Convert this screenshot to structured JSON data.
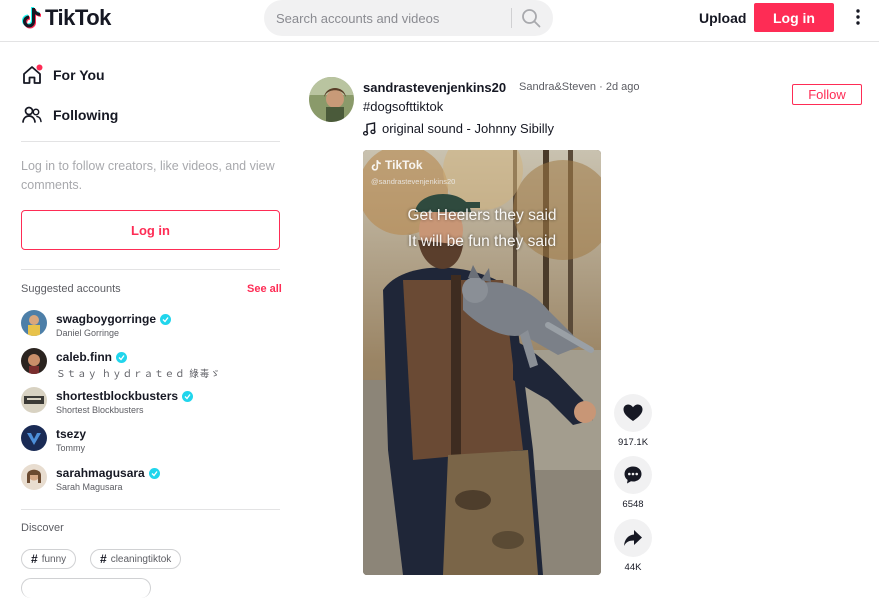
{
  "header": {
    "logo_text": "TikTok",
    "search_placeholder": "Search accounts and videos",
    "upload_label": "Upload",
    "login_label": "Log in"
  },
  "sidebar": {
    "nav": [
      {
        "label": "For You",
        "icon": "home-icon",
        "notification_dot": true
      },
      {
        "label": "Following",
        "icon": "following-icon"
      }
    ],
    "login_hint": "Log in to follow creators, like videos, and view comments.",
    "login_label": "Log in",
    "suggested_title": "Suggested accounts",
    "see_all": "See all",
    "accounts": [
      {
        "username": "swagboygorringe",
        "display": "Daniel Gorringe",
        "verified": true
      },
      {
        "username": "caleb.finn",
        "display": "Ｓｔａｙ ｈｙｄｒａｔｅｄ 綠毒ゞ",
        "verified": true
      },
      {
        "username": "shortestblockbusters",
        "display": "Shortest Blockbusters",
        "verified": true
      },
      {
        "username": "tsezy",
        "display": "Tommy",
        "verified": false
      },
      {
        "username": "sarahmagusara",
        "display": "Sarah Magusara",
        "verified": true
      }
    ],
    "discover_title": "Discover",
    "tags": [
      "funny",
      "cleaningtiktok"
    ]
  },
  "post": {
    "username": "sandrastevenjenkins20",
    "meta": "Sandra&Steven · 2d ago",
    "caption": "#dogsofttiktok",
    "sound": "original sound - Johnny Sibilly",
    "follow_label": "Follow",
    "video": {
      "watermark_logo": "TikTok",
      "watermark_handle": "@sandrastevenjenkins20",
      "overlay_line1": "Get Heelers they said",
      "overlay_line2": "It will be fun they said"
    },
    "likes": "917.1K",
    "comments": "6548",
    "shares": "44K"
  }
}
